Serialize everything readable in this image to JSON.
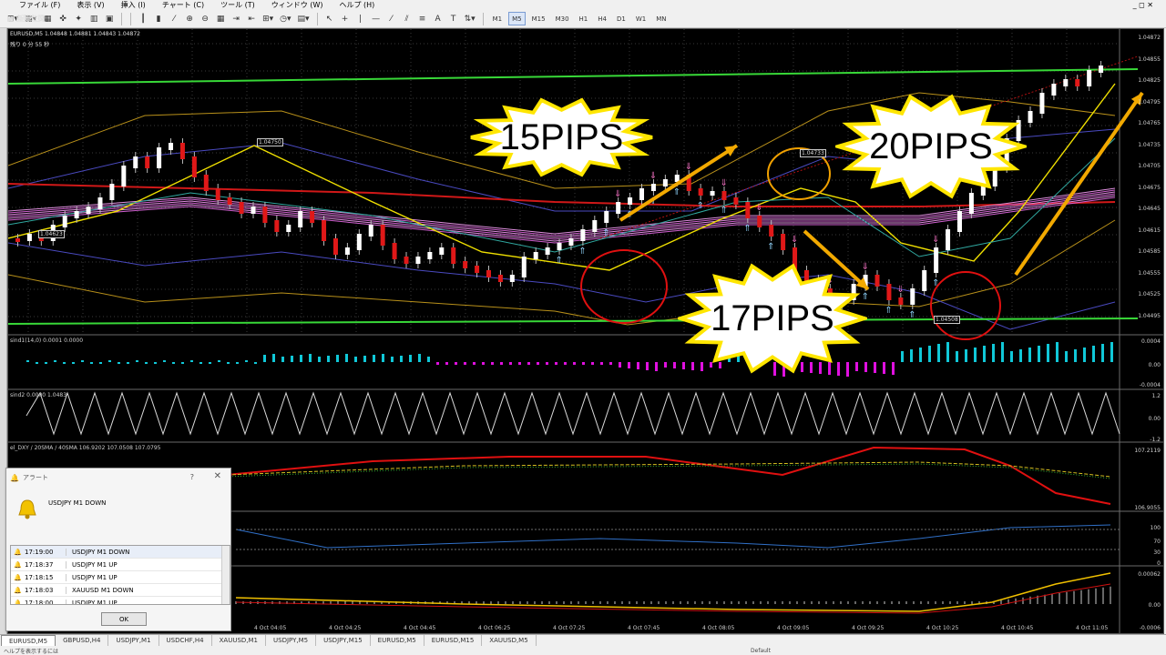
{
  "menu": {
    "items": [
      "ファイル (F)",
      "表示 (V)",
      "挿入 (I)",
      "チャート (C)",
      "ツール (T)",
      "ウィンドウ (W)",
      "ヘルプ (H)"
    ]
  },
  "toolbar": {
    "new_order": "新規注文",
    "auto_trade": "自動売買",
    "timeframes": [
      "M1",
      "M5",
      "M15",
      "M30",
      "H1",
      "H4",
      "D1",
      "W1",
      "MN"
    ],
    "active_timeframe": "M5"
  },
  "chart": {
    "header": "EURUSD,M5  1.04848 1.04881 1.04843 1.04872",
    "countdown": "残り 0 分 55 秒",
    "annotations": {
      "low1": "1.04623",
      "high1": "1.04750",
      "high2": "1.04733",
      "low2": "1.04508"
    },
    "price_ticks": [
      "1.04872",
      "1.04855",
      "1.04825",
      "1.04795",
      "1.04765",
      "1.04735",
      "1.04705",
      "1.04675",
      "1.04645",
      "1.04615",
      "1.04585",
      "1.04555",
      "1.04525",
      "1.04495"
    ],
    "time_ticks": [
      "4 Oct 04:05",
      "4 Oct 04:25",
      "4 Oct 04:45",
      "4 Oct 06:25",
      "4 Oct 07:25",
      "4 Oct 07:45",
      "4 Oct 08:05",
      "4 Oct 09:05",
      "4 Oct 09:25",
      "4 Oct 10:25",
      "4 Oct 10:45",
      "4 Oct 11:05"
    ],
    "bursts": [
      "15PIPS",
      "20PIPS",
      "17PIPS"
    ],
    "colors": {
      "burst_fill": "#ffffff",
      "burst_stroke": "#ffe600",
      "arrow": "#f2a900",
      "circle_red": "#e01010",
      "circle_orange": "#f0a000"
    }
  },
  "subwindows": [
    {
      "label": "sind1(14,0) 0.0001 0.0000",
      "ticks": [
        "0.0004",
        "0.00",
        "-0.0004"
      ]
    },
    {
      "label": "sind2 0.0000 1.0483",
      "ticks": [
        "1.2",
        "0.00",
        "-1.2"
      ]
    },
    {
      "label": "el_DXY / 20SMA / 40SMA 106.9202 107.0508 107.0795",
      "ticks": [
        "107.2119",
        "106.9055"
      ]
    },
    {
      "label": "",
      "ticks": [
        "100",
        "70",
        "30",
        "0"
      ]
    },
    {
      "label": "",
      "ticks": [
        "0.00062",
        "0.00",
        "-0.0006"
      ]
    }
  ],
  "alert": {
    "title": "アラート",
    "help": "?",
    "close": "✕",
    "message": "USDJPY M1 DOWN",
    "rows": [
      {
        "time": "17:19:00",
        "text": "USDJPY M1 DOWN"
      },
      {
        "time": "17:18:37",
        "text": "USDJPY M1 UP"
      },
      {
        "time": "17:18:15",
        "text": "USDJPY M1 UP"
      },
      {
        "time": "17:18:03",
        "text": "XAUUSD M1 DOWN"
      },
      {
        "time": "17:18:00",
        "text": "USDJPY M1 UP"
      }
    ],
    "ok": "OK"
  },
  "tabs": [
    "EURUSD,M5",
    "GBPUSD,H4",
    "USDJPY,M1",
    "USDCHF,H4",
    "XAUUSD,M1",
    "USDJPY,M5",
    "USDJPY,M15",
    "EURUSD,M5",
    "EURUSD,M15",
    "XAUUSD,M5"
  ],
  "status": {
    "left": "ヘルプを表示するには",
    "mid": "Default"
  }
}
